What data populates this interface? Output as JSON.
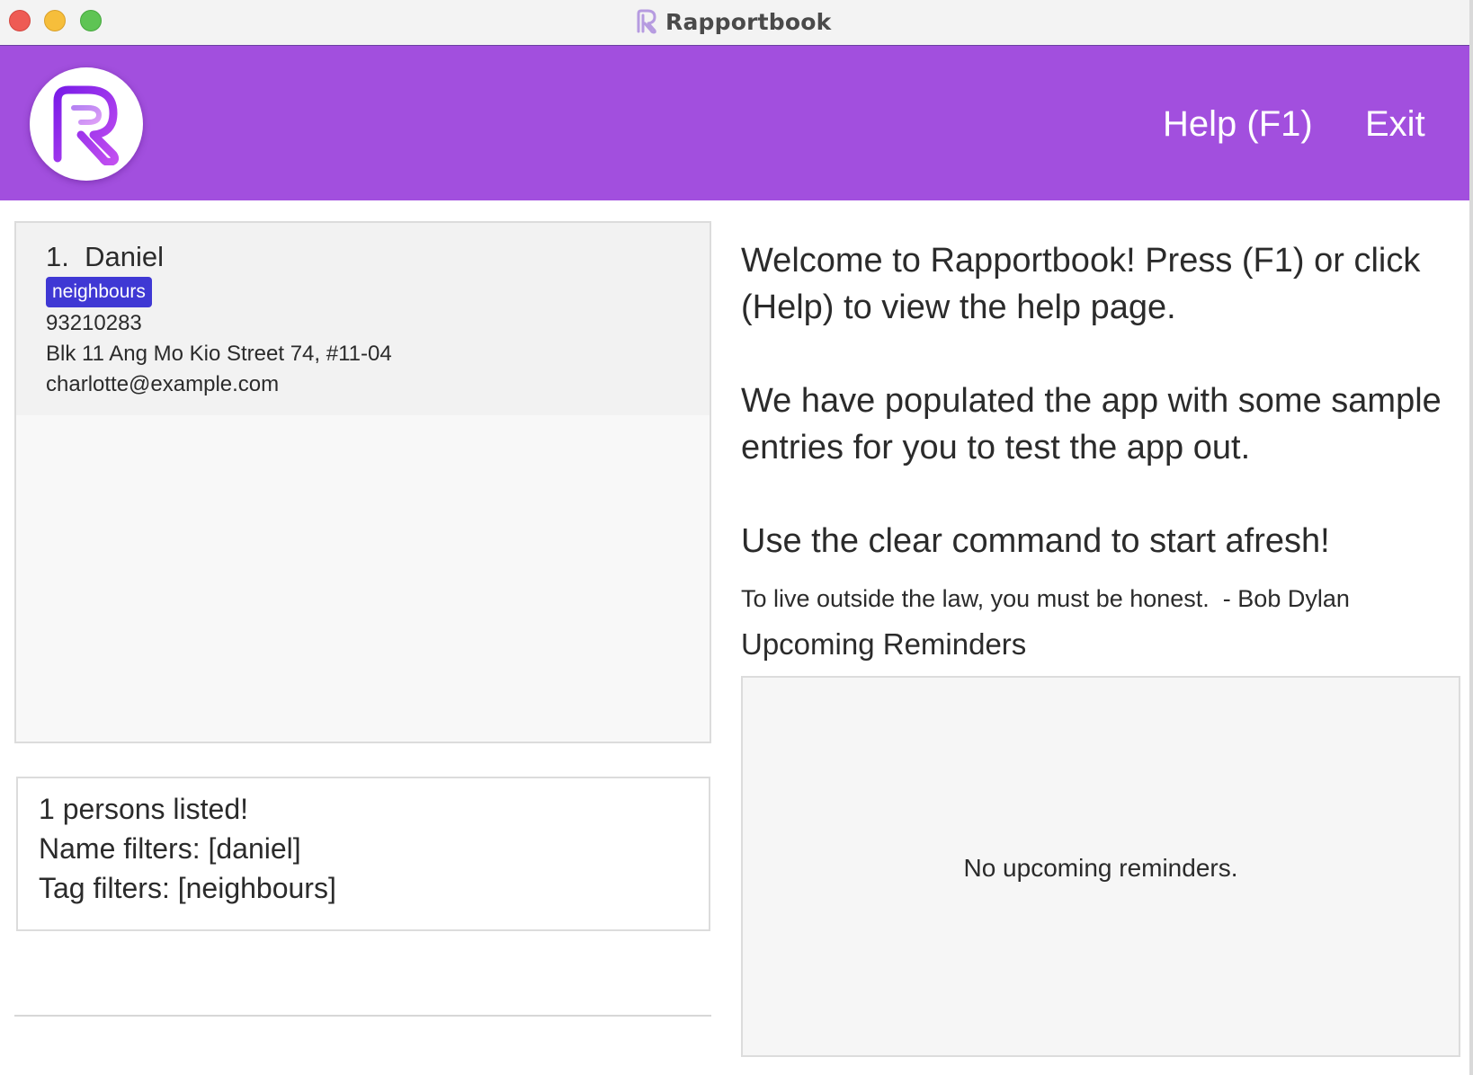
{
  "window": {
    "title": "Rapportbook",
    "brand_color": "#a24fde",
    "logo_icon": "r-logo-icon"
  },
  "menu": {
    "help_label": "Help (F1)",
    "exit_label": "Exit"
  },
  "person_list": {
    "persons": [
      {
        "index": "1.",
        "name": "Daniel",
        "tags": [
          "neighbours"
        ],
        "phone": "93210283",
        "address": "Blk 11 Ang Mo Kio Street 74, #11-04",
        "email": "charlotte@example.com"
      }
    ],
    "tag_color": "#3f38d4"
  },
  "result": {
    "line1": "1 persons listed!",
    "line2": "Name filters: [daniel]",
    "line3": "Tag filters: [neighbours]"
  },
  "command_box": {
    "value": ""
  },
  "welcome": {
    "paragraph1": "Welcome to Rapportbook! Press (F1) or click (Help) to view the help page.",
    "paragraph2": "We have populated the app with some sample entries for you to test the app out.",
    "paragraph3": "Use the clear command to start afresh!",
    "quote": "To live outside the law, you must be honest.  - Bob Dylan"
  },
  "reminders": {
    "heading": "Upcoming Reminders",
    "empty_text": "No upcoming reminders."
  }
}
